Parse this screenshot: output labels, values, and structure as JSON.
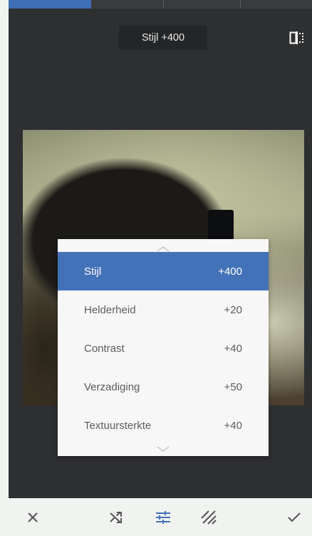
{
  "top_tabs": [
    "",
    "",
    "",
    ""
  ],
  "header": {
    "value_label": "Stijl +400",
    "compare_icon": "compare-icon"
  },
  "adjust_menu": {
    "items": [
      {
        "label": "Stijl",
        "value": "+400",
        "selected": true
      },
      {
        "label": "Helderheid",
        "value": "+20",
        "selected": false
      },
      {
        "label": "Contrast",
        "value": "+40",
        "selected": false
      },
      {
        "label": "Verzadiging",
        "value": "+50",
        "selected": false
      },
      {
        "label": "Textuursterkte",
        "value": "+40",
        "selected": false
      }
    ]
  },
  "toolbar": {
    "icons": [
      "close-icon",
      "shuffle-icon",
      "tune-icon",
      "styles-icon",
      "check-icon"
    ]
  },
  "colors": {
    "accent": "#4472b8",
    "editor_background": "#2e2f31",
    "menu_background": "#f7f7f7",
    "toolbar_background": "#f1f3f1"
  }
}
